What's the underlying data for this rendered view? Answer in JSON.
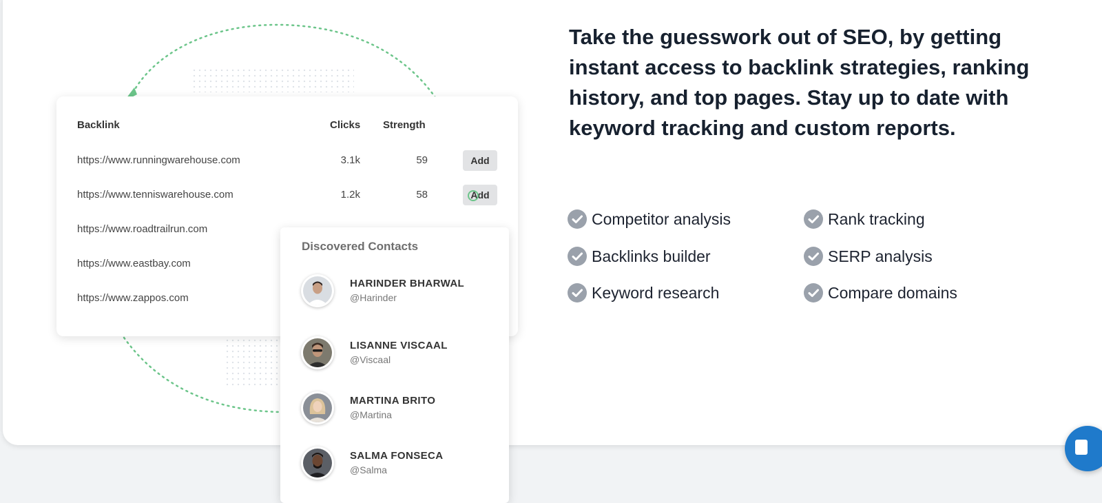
{
  "headline": "Take the guesswork out of SEO, by getting instant access to backlink strategies, ranking history, and top pages. Stay up to date with keyword tracking and custom reports.",
  "features": [
    {
      "label": "Competitor analysis",
      "icon": "check-circle-icon"
    },
    {
      "label": "Rank tracking",
      "icon": "check-circle-icon"
    },
    {
      "label": "Backlinks builder",
      "icon": "check-circle-icon"
    },
    {
      "label": "SERP analysis",
      "icon": "check-circle-icon"
    },
    {
      "label": "Keyword research",
      "icon": "check-circle-icon"
    },
    {
      "label": "Compare domains",
      "icon": "check-circle-icon"
    }
  ],
  "backlinks": {
    "headers": {
      "backlink": "Backlink",
      "clicks": "Clicks",
      "strength": "Strength"
    },
    "add_label": "Add",
    "rows": [
      {
        "url": "https://www.runningwarehouse.com",
        "clicks": "3.1k",
        "strength": "59"
      },
      {
        "url": "https://www.tenniswarehouse.com",
        "clicks": "1.2k",
        "strength": "58"
      },
      {
        "url": "https://www.roadtrailrun.com"
      },
      {
        "url": "https://www.eastbay.com"
      },
      {
        "url": "https://www.zappos.com"
      }
    ]
  },
  "contacts": {
    "title": "Discovered Contacts",
    "items": [
      {
        "name": "HARINDER BHARWAL",
        "handle": "@Harinder"
      },
      {
        "name": "LISANNE VISCAAL",
        "handle": "@Viscaal"
      },
      {
        "name": "MARTINA BRITO",
        "handle": "@Martina"
      },
      {
        "name": "SALMA FONSECA",
        "handle": "@Salma"
      }
    ]
  },
  "colors": {
    "accent_green": "#6cc58a",
    "check_gray": "#9aa1ab",
    "headline_text": "#17212f",
    "chat_blue": "#1f7acb"
  },
  "icons": {
    "chat": "chat-icon",
    "arrow": "dotted-arrow-icon"
  }
}
